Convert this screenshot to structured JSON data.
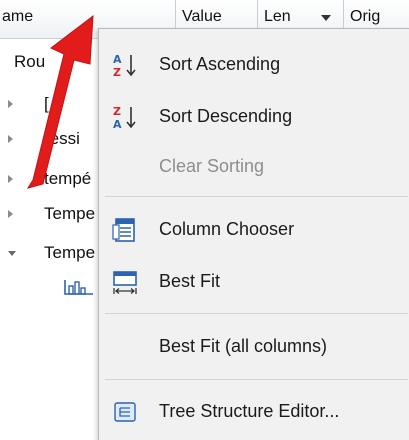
{
  "grid": {
    "columns": {
      "name": "ame",
      "value": "Value",
      "len": "Len",
      "orig": "Orig"
    },
    "rows": [
      {
        "label": "Rou",
        "expander": "none",
        "icon": ""
      },
      {
        "label": "[",
        "expander": "collapsed",
        "icon": ""
      },
      {
        "label": "ressi",
        "expander": "collapsed",
        "icon": ""
      },
      {
        "label": "tempé",
        "expander": "collapsed",
        "icon": ""
      },
      {
        "label": "Tempe",
        "expander": "collapsed",
        "icon": ""
      },
      {
        "label": "Tempe",
        "expander": "expanded",
        "icon": ""
      },
      {
        "label": "",
        "expander": "none",
        "icon": "chart-icon"
      }
    ]
  },
  "menu": {
    "sort_ascending": "Sort Ascending",
    "sort_descending": "Sort Descending",
    "clear_sorting": "Clear Sorting",
    "column_chooser": "Column Chooser",
    "best_fit": "Best Fit",
    "best_fit_all": "Best Fit (all columns)",
    "tree_structure_editor": "Tree Structure Editor...",
    "icons": {
      "sort_ascending": "sort-ascending-icon",
      "sort_descending": "sort-descending-icon",
      "column_chooser": "column-chooser-icon",
      "best_fit": "best-fit-icon",
      "tree_structure_editor": "tree-structure-icon"
    }
  },
  "colors": {
    "menu_background": "#f1f1f1",
    "disabled_text": "#8e8e8e",
    "icon_red": "#d9262b",
    "icon_blue": "#2d63b0",
    "annotation_arrow": "#e21b1b"
  }
}
